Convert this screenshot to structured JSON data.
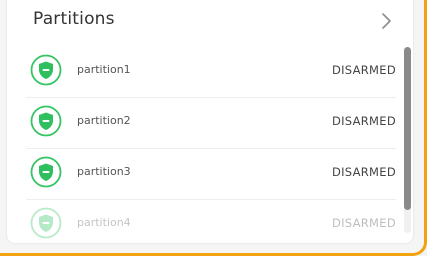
{
  "header": {
    "title": "Partitions"
  },
  "partitions": [
    {
      "name": "partition1",
      "status": "DISARMED"
    },
    {
      "name": "partition2",
      "status": "DISARMED"
    },
    {
      "name": "partition3",
      "status": "DISARMED"
    },
    {
      "name": "partition4",
      "status": "DISARMED"
    }
  ],
  "icons": {
    "header_chevron": "chevron-right-icon",
    "partition_status": "shield-icon"
  },
  "colors": {
    "accent_border": "#f2a20f",
    "shield_green": "#2fbf5f",
    "shield_ring": "#35c463"
  }
}
